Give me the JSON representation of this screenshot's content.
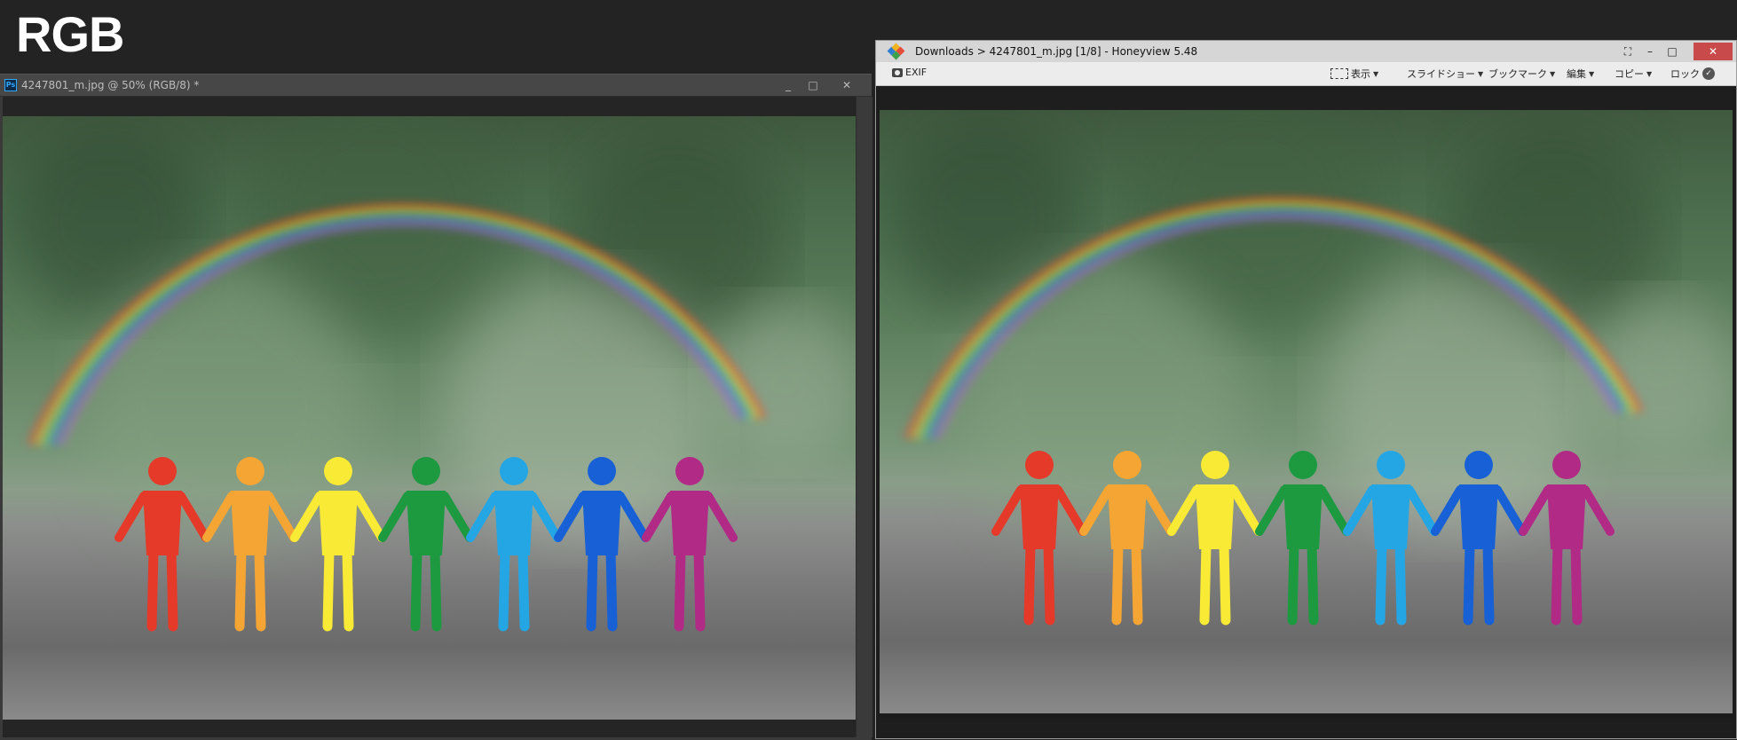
{
  "label": "RGB",
  "photoshop": {
    "title": "4247801_m.jpg @ 50% (RGB/8) *",
    "app_icon_text": "Ps",
    "controls": {
      "minimize": "_",
      "maximize": "□",
      "close": "✕"
    }
  },
  "honeyview": {
    "title": "Downloads > 4247801_m.jpg [1/8] - Honeyview 5.48",
    "controls": {
      "fullscreen": "⛶",
      "minimize": "–",
      "maximize": "□",
      "close": "✕"
    },
    "toolbar": {
      "exif": "EXIF",
      "display": "表示",
      "slideshow": "スライドショー",
      "bookmark": "ブックマーク",
      "edit": "編集",
      "copy": "コピー",
      "lock": "ロック"
    }
  },
  "figure_colors": [
    "#e53a2a",
    "#f4a534",
    "#f9ea36",
    "#1d9a40",
    "#25a6e4",
    "#1760d6",
    "#b02a86"
  ]
}
